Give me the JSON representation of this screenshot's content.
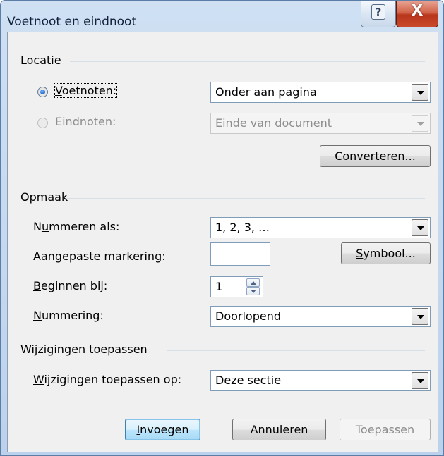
{
  "window": {
    "title": "Voetnoot en eindnoot"
  },
  "titlebar": {
    "help_label": "?",
    "close_label": "X"
  },
  "location": {
    "heading": "Locatie",
    "footnotes": {
      "pre": "",
      "key": "V",
      "post": "oetnoten:",
      "selected": true,
      "value": "Onder aan pagina"
    },
    "endnotes": {
      "label": "Eindnoten:",
      "selected": false,
      "enabled": false,
      "value": "Einde van document"
    },
    "convert": {
      "key": "C",
      "post": "onverteren..."
    }
  },
  "format": {
    "heading": "Opmaak",
    "number_as": {
      "pre": "N",
      "key": "u",
      "post": "mmeren als:",
      "value": "1, 2, 3, …"
    },
    "custom_mark": {
      "pre": "Aangepaste ",
      "key": "m",
      "post": "arkering:",
      "value": ""
    },
    "symbol": {
      "key": "S",
      "post": "ymbool..."
    },
    "start_at": {
      "pre": "",
      "key": "B",
      "post": "eginnen bij:",
      "value": "1"
    },
    "numbering": {
      "pre": "",
      "key": "N",
      "post": "ummering:",
      "value": "Doorlopend"
    }
  },
  "apply": {
    "heading": "Wijzigingen toepassen",
    "apply_to": {
      "pre": "",
      "key": "W",
      "post": "ijzigingen toepassen op:",
      "value": "Deze sectie"
    }
  },
  "buttons": {
    "insert": {
      "key": "I",
      "post": "nvoegen"
    },
    "cancel": "Annuleren",
    "apply": "Toepassen"
  },
  "colors": {
    "accent": "#3c7fb1",
    "close": "#c9492c",
    "frame": "#bcd2ec"
  }
}
